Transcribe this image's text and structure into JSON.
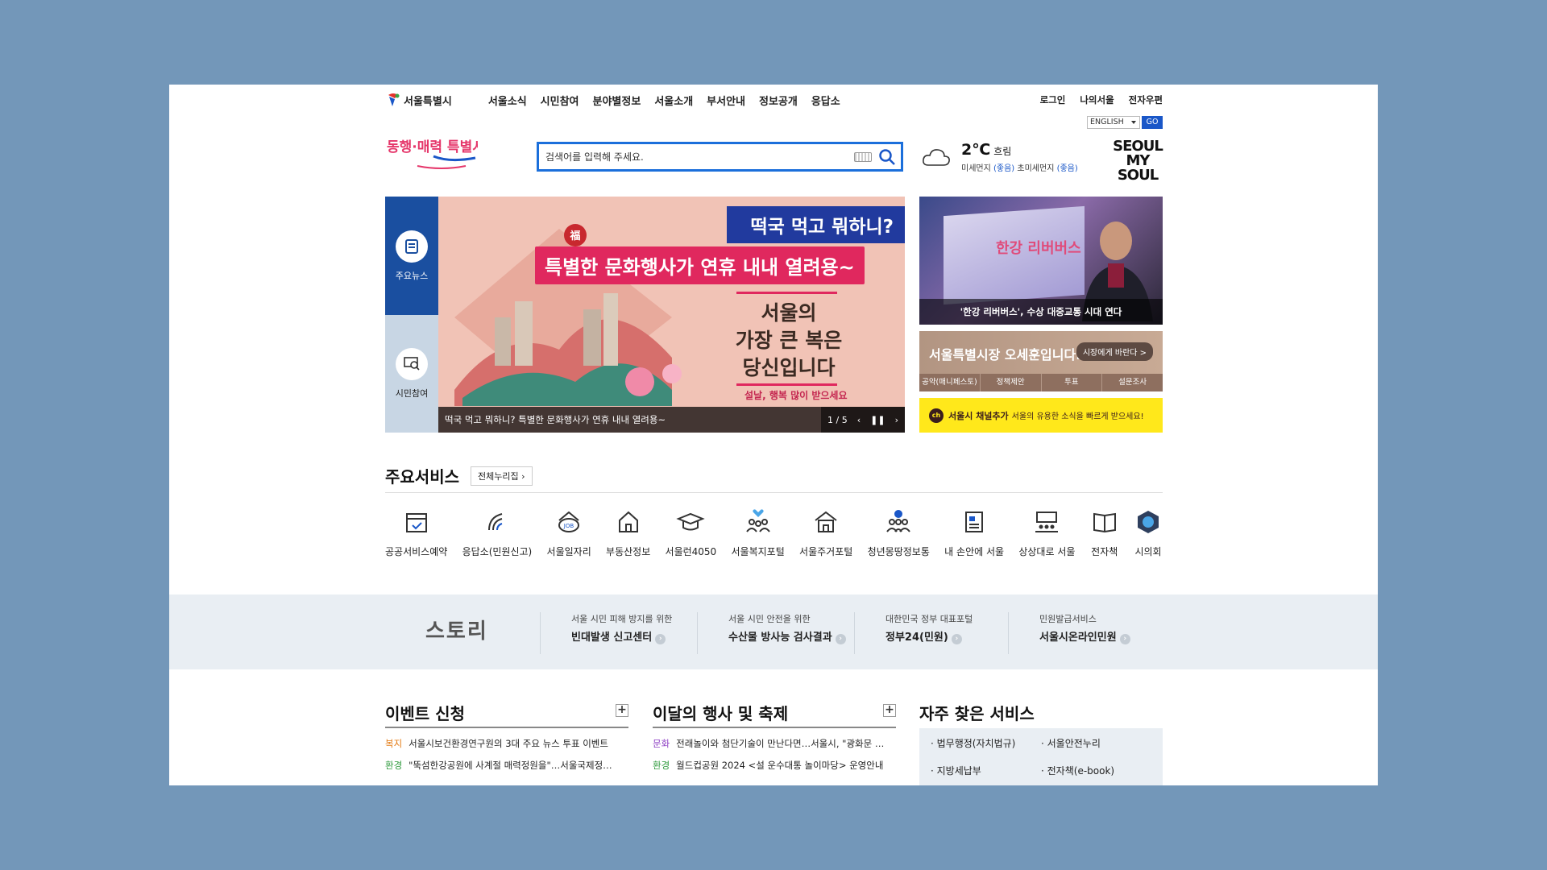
{
  "gnb": {
    "logo_text": "서울특별시",
    "menu": [
      "서울소식",
      "시민참여",
      "분야별정보",
      "서울소개",
      "부서안내",
      "정보공개",
      "응답소"
    ],
    "util": [
      "로그인",
      "나의서울",
      "전자우편"
    ]
  },
  "lang": {
    "selected": "ENGLISH",
    "go": "GO"
  },
  "slogan": "동행·매력 특별시 서울",
  "search": {
    "placeholder": "검색어를 입력해 주세요."
  },
  "weather": {
    "temp": "2℃",
    "condition": "흐림",
    "dust_label": "미세먼지",
    "dust_value": "(좋음)",
    "ultra_label": "초미세먼지",
    "ultra_value": "(좋음)"
  },
  "seoul_brand": {
    "line1": "SEOUL",
    "line2": "MY SOUL"
  },
  "hero_tabs": {
    "news": "주요뉴스",
    "participation": "시민참여"
  },
  "banner": {
    "headline_top": "떡국 먹고 뭐하니?",
    "headline_mid": "특별한 문화행사가 연휴 내내 열려용~",
    "main_line1": "서울의",
    "main_line2": "가장 큰 복은",
    "main_line3": "당신입니다",
    "sub": "설날, 행복 많이 받으세요",
    "caption": "떡국 먹고 뭐하니? 특별한 문화행사가 연휴 내내 열려용~",
    "page": "1 / 5",
    "badge": "福"
  },
  "side_news": {
    "screen_text": "한강 리버버스",
    "caption": "'한강 리버버스', 수상 대중교통 시대 연다"
  },
  "mayor": {
    "title": "서울특별시장 오세훈입니다.",
    "button": "시장에게 바란다 >",
    "links": [
      "공약(매니페스토)",
      "정책제안",
      "투표",
      "설문조사"
    ]
  },
  "kakao": {
    "badge": "ch",
    "title": "서울시 채널추가",
    "desc": "서울의 유용한 소식을 빠르게 받으세요!"
  },
  "services": {
    "title": "주요서비스",
    "all_button": "전체누리집",
    "items": [
      {
        "label": "공공서비스예약",
        "icon": "calendar-check-icon"
      },
      {
        "label": "응답소(민원신고)",
        "icon": "signal-icon"
      },
      {
        "label": "서울일자리",
        "icon": "job-icon"
      },
      {
        "label": "부동산정보",
        "icon": "house-icon"
      },
      {
        "label": "서울런4050",
        "icon": "graduation-cap-icon"
      },
      {
        "label": "서울복지포털",
        "icon": "family-heart-icon"
      },
      {
        "label": "서울주거포털",
        "icon": "building-icon"
      },
      {
        "label": "청년몽땅정보통",
        "icon": "youth-group-icon"
      },
      {
        "label": "내 손안에 서울",
        "icon": "mobile-news-icon"
      },
      {
        "label": "상상대로 서울",
        "icon": "meeting-icon"
      },
      {
        "label": "전자책",
        "icon": "ebook-icon"
      },
      {
        "label": "시의회",
        "icon": "council-emblem-icon"
      }
    ]
  },
  "band": {
    "logo": "스토리",
    "items": [
      {
        "small": "서울 시민 피해 방지를 위한",
        "big": "빈대발생 신고센터"
      },
      {
        "small": "서울 시민 안전을 위한",
        "big": "수산물 방사능 검사결과"
      },
      {
        "small": "대한민국 정부 대표포털",
        "big": "정부24(민원)"
      },
      {
        "small": "민원발급서비스",
        "big": "서울시온라인민원"
      }
    ]
  },
  "events": {
    "title": "이벤트 신청",
    "items": [
      {
        "cat": "복지",
        "text": "서울시보건환경연구원의 3대 주요 뉴스 투표 이벤트"
      },
      {
        "cat": "환경",
        "text": "\"뚝섬한강공원에 사계절 매력정원을\"…서울국제정…"
      }
    ]
  },
  "festivals": {
    "title": "이달의 행사 및 축제",
    "items": [
      {
        "cat": "문화",
        "text": "전래놀이와 첨단기술이 만난다면…서울시, \"광화문 …"
      },
      {
        "cat": "환경",
        "text": "월드컵공원 2024 <설 운수대통 놀이마당> 운영안내"
      }
    ]
  },
  "frequent": {
    "title": "자주 찾은 서비스",
    "items": [
      "법무행정(자치법규)",
      "서울안전누리",
      "지방세납부",
      "전자책(e-book)"
    ]
  },
  "colors": {
    "background": "#7397b9",
    "primary_blue": "#1a4fa0",
    "search_border": "#1b6fdb",
    "kakao_yellow": "#ffe81b"
  }
}
